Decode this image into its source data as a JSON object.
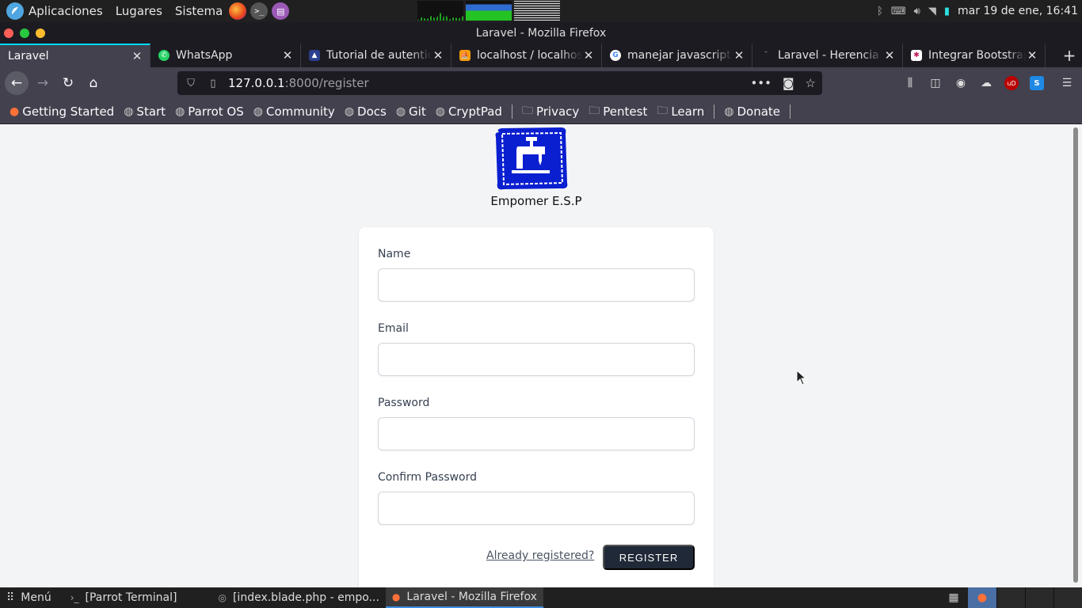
{
  "top_panel": {
    "menu": [
      "Aplicaciones",
      "Lugares",
      "Sistema"
    ],
    "clock": "mar 19 de ene, 16:41"
  },
  "window": {
    "title": "Laravel - Mozilla Firefox"
  },
  "tabs": [
    {
      "label": "Laravel",
      "favicon": "none",
      "active": true
    },
    {
      "label": "WhatsApp",
      "favicon": "whatsapp-icon",
      "color": "#25d366"
    },
    {
      "label": "Tutorial de autentic",
      "favicon": "rocket-icon",
      "color": "#2b3f8e"
    },
    {
      "label": "localhost / localhost",
      "favicon": "phpmyadmin-icon",
      "color": "#f89c0e"
    },
    {
      "label": "manejar javascript y",
      "favicon": "google-icon",
      "color": "#4285f4"
    },
    {
      "label": "Laravel - Herencia d",
      "favicon": "none"
    },
    {
      "label": "Integrar Bootstrap c",
      "favicon": "bootstrap-icon",
      "color": "#c2185b"
    }
  ],
  "url": {
    "host": "127.0.0.1",
    "path": ":8000/register"
  },
  "bookmarks": [
    {
      "label": "Getting Started",
      "icon": "firefox-icon"
    },
    {
      "label": "Start",
      "icon": "globe-icon"
    },
    {
      "label": "Parrot OS",
      "icon": "globe-icon"
    },
    {
      "label": "Community",
      "icon": "globe-icon"
    },
    {
      "label": "Docs",
      "icon": "globe-icon"
    },
    {
      "label": "Git",
      "icon": "globe-icon"
    },
    {
      "label": "CryptPad",
      "icon": "globe-icon"
    },
    {
      "label": "Privacy",
      "icon": "folder-icon"
    },
    {
      "label": "Pentest",
      "icon": "folder-icon"
    },
    {
      "label": "Learn",
      "icon": "folder-icon"
    },
    {
      "label": "Donate",
      "icon": "globe-icon"
    }
  ],
  "page": {
    "brand": "Empomer E.S.P",
    "form": {
      "name_label": "Name",
      "email_label": "Email",
      "password_label": "Password",
      "confirm_label": "Confirm Password",
      "name_value": "",
      "email_value": "",
      "password_value": "",
      "confirm_value": "",
      "already_link": "Already registered?",
      "submit_label": "REGISTER"
    }
  },
  "taskbar": {
    "menu_label": "Menú",
    "items": [
      {
        "label": "[Parrot Terminal]",
        "active": false
      },
      {
        "label": "[index.blade.php - empo...",
        "active": false
      },
      {
        "label": "Laravel - Mozilla Firefox",
        "active": true
      }
    ]
  },
  "colors": {
    "button": "#1f2937",
    "logo_blue": "#0a1fd0",
    "page_bg": "#f3f4f6"
  }
}
